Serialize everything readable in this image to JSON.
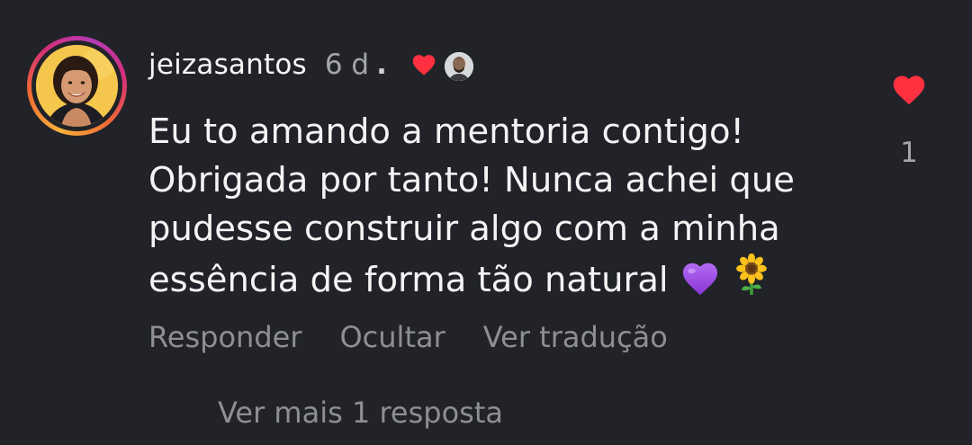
{
  "comment": {
    "username": "jeizasantos",
    "time": "6 d",
    "separator": ".",
    "text_lines": [
      "Eu to amando a mentoria contigo!",
      "Obrigada por tanto! Nunca achei que",
      "pudesse construir algo com a minha",
      "essência de forma tão natural"
    ],
    "emojis": [
      "purple-heart",
      "sunflower"
    ],
    "likes": "1"
  },
  "actions": {
    "reply": "Responder",
    "hide": "Ocultar",
    "translate": "Ver tradução"
  },
  "replies": {
    "view_more": "Ver mais 1 resposta"
  },
  "colors": {
    "background": "#212328",
    "like_red": "#ff3040",
    "muted_text": "#8d8f94"
  }
}
